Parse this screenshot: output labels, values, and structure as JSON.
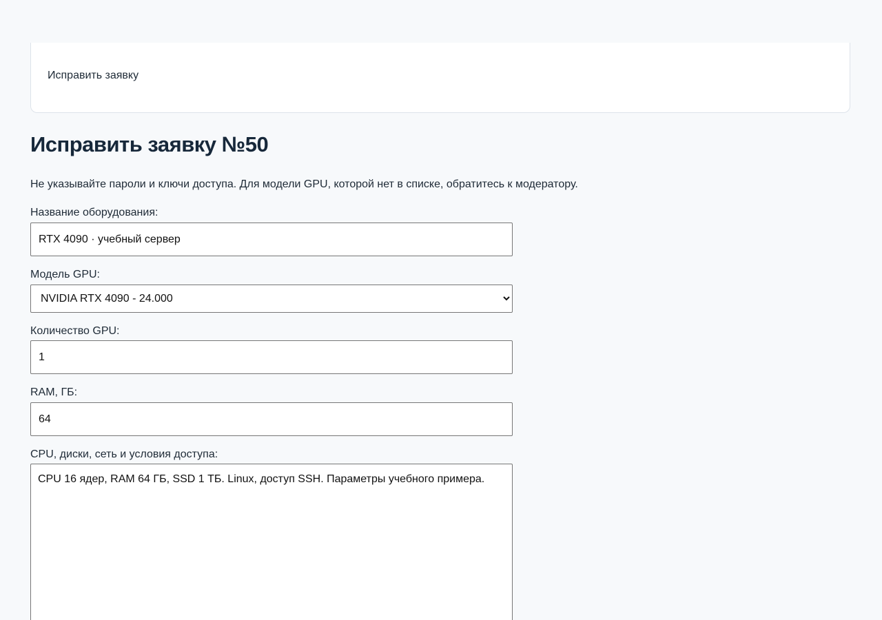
{
  "banner": {
    "text": "Исправить заявку"
  },
  "page": {
    "title": "Исправить заявку №50",
    "hint": "Не указывайте пароли и ключи доступа. Для модели GPU, которой нет в списке, обратитесь к модератору."
  },
  "form": {
    "name": {
      "label": "Название оборудования:",
      "value": "RTX 4090 · учебный сервер"
    },
    "gpu_model": {
      "label": "Модель GPU:",
      "selected": "NVIDIA RTX 4090 - 24.000"
    },
    "gpu_count": {
      "label": "Количество GPU:",
      "value": "1"
    },
    "ram": {
      "label": "RAM, ГБ:",
      "value": "64"
    },
    "details": {
      "label": "CPU, диски, сеть и условия доступа:",
      "value": "CPU 16 ядер, RAM 64 ГБ, SSD 1 ТБ. Linux, доступ SSH. Параметры учебного примера."
    }
  }
}
